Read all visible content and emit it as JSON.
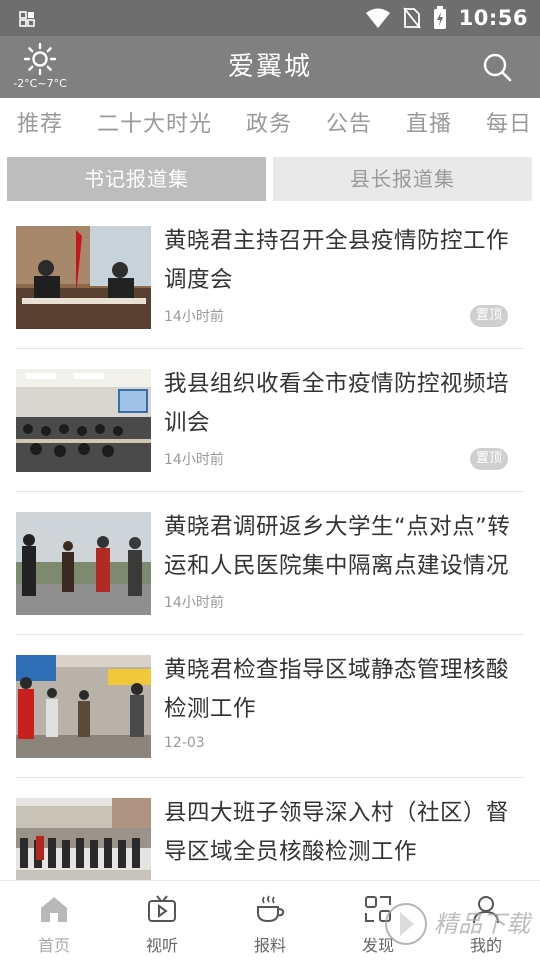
{
  "status_bar": {
    "time": "10:56"
  },
  "header": {
    "title": "爱翼城",
    "weather_temp": "-2°C~7°C"
  },
  "tabs": [
    {
      "label": "推荐"
    },
    {
      "label": "二十大时光"
    },
    {
      "label": "政务"
    },
    {
      "label": "公告"
    },
    {
      "label": "直播"
    },
    {
      "label": "每日"
    }
  ],
  "segments": {
    "active": "书记报道集",
    "inactive": "县长报道集"
  },
  "news": [
    {
      "title": "黄晓君主持召开全县疫情防控工作调度会",
      "time": "14小时前",
      "badge": "置顶"
    },
    {
      "title": "我县组织收看全市疫情防控视频培训会",
      "time": "14小时前",
      "badge": "置顶"
    },
    {
      "title": "黄晓君调研返乡大学生“点对点”转运和人民医院集中隔离点建设情况",
      "time": "14小时前"
    },
    {
      "title": "黄晓君检查指导区域静态管理核酸检测工作",
      "time": "12-03"
    },
    {
      "title": "县四大班子领导深入村（社区）督导区域全员核酸检测工作",
      "time": ""
    }
  ],
  "bottom_nav": [
    {
      "label": "首页",
      "icon": "home-icon"
    },
    {
      "label": "视听",
      "icon": "tv-icon"
    },
    {
      "label": "报料",
      "icon": "coffee-icon"
    },
    {
      "label": "发现",
      "icon": "scan-icon"
    },
    {
      "label": "我的",
      "icon": "user-icon"
    }
  ],
  "watermark": {
    "text": "精品下载"
  }
}
